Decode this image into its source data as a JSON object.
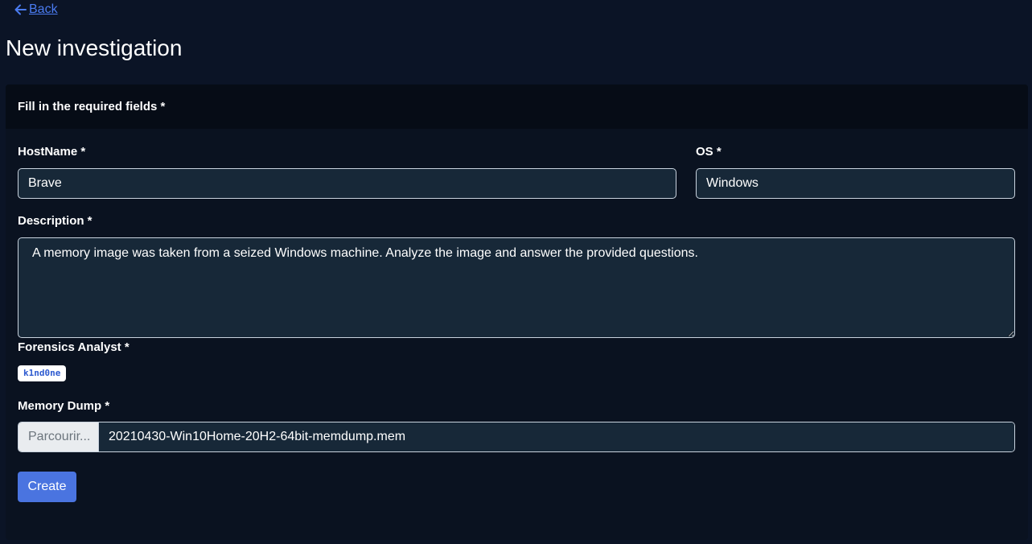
{
  "nav": {
    "back_label": "Back"
  },
  "page": {
    "title": "New investigation"
  },
  "form": {
    "header": "Fill in the required fields *",
    "hostname_label": "HostName *",
    "hostname_value": "Brave",
    "os_label": "OS *",
    "os_value": "Windows",
    "description_label": "Description *",
    "description_value": "A memory image was taken from a seized Windows machine. Analyze the image and answer the provided questions.",
    "analyst_label": "Forensics Analyst  *",
    "analyst_tag": "k1nd0ne",
    "memory_label": "Memory Dump *",
    "memory_browse_label": "Parcourir...",
    "memory_file_name": "20210430-Win10Home-20H2-64bit-memdump.mem",
    "create_label": "Create"
  },
  "icons": {
    "back": "arrow-left-icon"
  },
  "colors": {
    "background": "#0b1426",
    "card": "#0a1220",
    "card_header": "#060c16",
    "input": "#172838",
    "accent": "#4a74e0",
    "link": "#4a7bf0"
  }
}
